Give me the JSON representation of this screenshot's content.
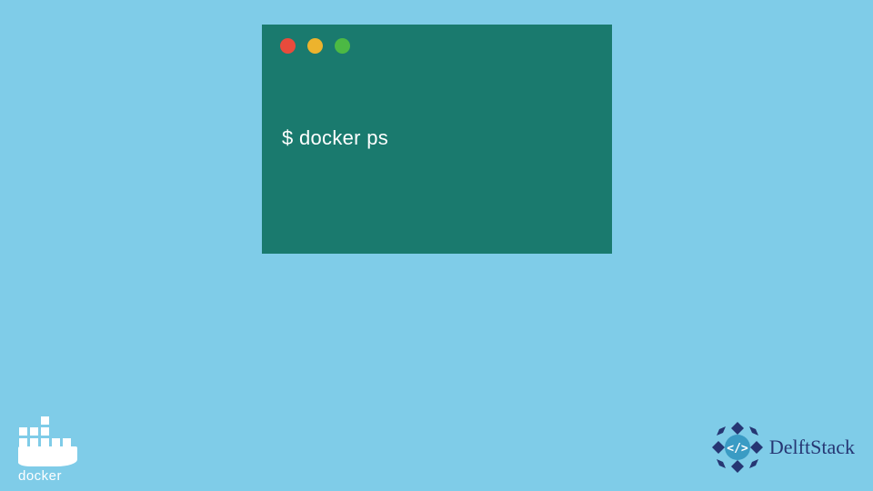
{
  "terminal": {
    "command": "$ docker ps"
  },
  "logos": {
    "docker": {
      "label": "docker"
    },
    "delftstack": {
      "label": "DelftStack"
    }
  },
  "colors": {
    "background": "#7fcce8",
    "terminal_bg": "#1a7a6e",
    "traffic_red": "#e94b3c",
    "traffic_yellow": "#edb32d",
    "traffic_green": "#4cb944",
    "delftstack_primary": "#263673"
  }
}
